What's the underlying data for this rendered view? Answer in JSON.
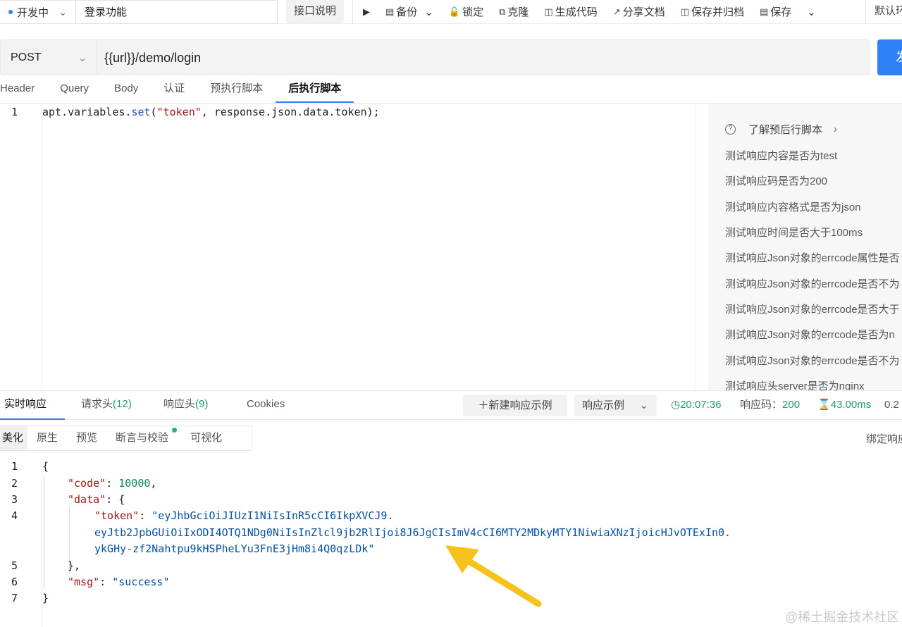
{
  "toolbar": {
    "status": "开发中",
    "api_name": "登录功能",
    "doc_button": "接口说明",
    "backup": "备份",
    "lock": "锁定",
    "clone": "克隆",
    "gen_code": "生成代码",
    "share_doc": "分享文档",
    "save_archive": "保存并归档",
    "save": "保存",
    "default_env": "默认环"
  },
  "request": {
    "method": "POST",
    "url": "{{url}}/demo/login",
    "send_label": "发",
    "tabs": [
      "Header",
      "Query",
      "Body",
      "认证",
      "预执行脚本",
      "后执行脚本"
    ],
    "active_tab": "后执行脚本"
  },
  "script": {
    "line_numbers": [
      "1"
    ],
    "code_obj": "apt.variables.",
    "code_method": "set",
    "code_open": "(",
    "code_str": "\"token\"",
    "code_rest": ", response.json.data.token);"
  },
  "snippets": {
    "header": "了解预后行脚本",
    "items": [
      "测试响应内容是否为test",
      "测试响应码是否为200",
      "测试响应内容格式是否为json",
      "测试响应时间是否大于100ms",
      "测试响应Json对象的errcode属性是否",
      "测试响应Json对象的errcode是否不为",
      "测试响应Json对象的errcode是否大于",
      "测试响应Json对象的errcode是否为n",
      "测试响应Json对象的errcode是否不为",
      "测试响应头server是否为nginx"
    ]
  },
  "response": {
    "tabs": {
      "realtime": "实时响应",
      "req_headers": "请求头",
      "req_headers_count": "(12)",
      "resp_headers": "响应头",
      "resp_headers_count": "(9)",
      "cookies": "Cookies"
    },
    "new_example": "新建响应示例",
    "example_select": "响应示例",
    "time": "20:07:36",
    "code_label": "响应码：",
    "code_value": "200",
    "duration": "43.00ms",
    "size": "0.2",
    "format_tabs": [
      "美化",
      "原生",
      "预览",
      "断言与校验",
      "可视化"
    ],
    "bind": "绑定响应",
    "line_numbers": [
      "1",
      "2",
      "3",
      "4",
      "5",
      "6",
      "7"
    ],
    "json": {
      "open": "{",
      "code_key": "\"code\"",
      "code_val": "10000",
      "data_key": "\"data\"",
      "token_key": "\"token\"",
      "token_part1": "\"eyJhbGciOiJIUzI1NiIsInR5cCI6IkpXVCJ9.",
      "token_part2": "eyJtb2JpbGUiOiIxODI4OTQ1NDg0NiIsInZlcl9jb2RlIjoi8J6JgCIsImV4cCI6MTY2MDkyMTY1NiwiaXNzIjoicHJvOTExIn0.",
      "token_part3": "ykGHy-zf2Nahtpu9kHSPheLYu3FnE3jHm8i4Q0qzLDk\"",
      "msg_key": "\"msg\"",
      "msg_val": "\"success\"",
      "close": "}"
    }
  },
  "watermark": "@稀土掘金技术社区",
  "colors": {
    "accent": "#2f7ff7",
    "success": "#1f9d6b",
    "arrow": "#f7c21c"
  }
}
